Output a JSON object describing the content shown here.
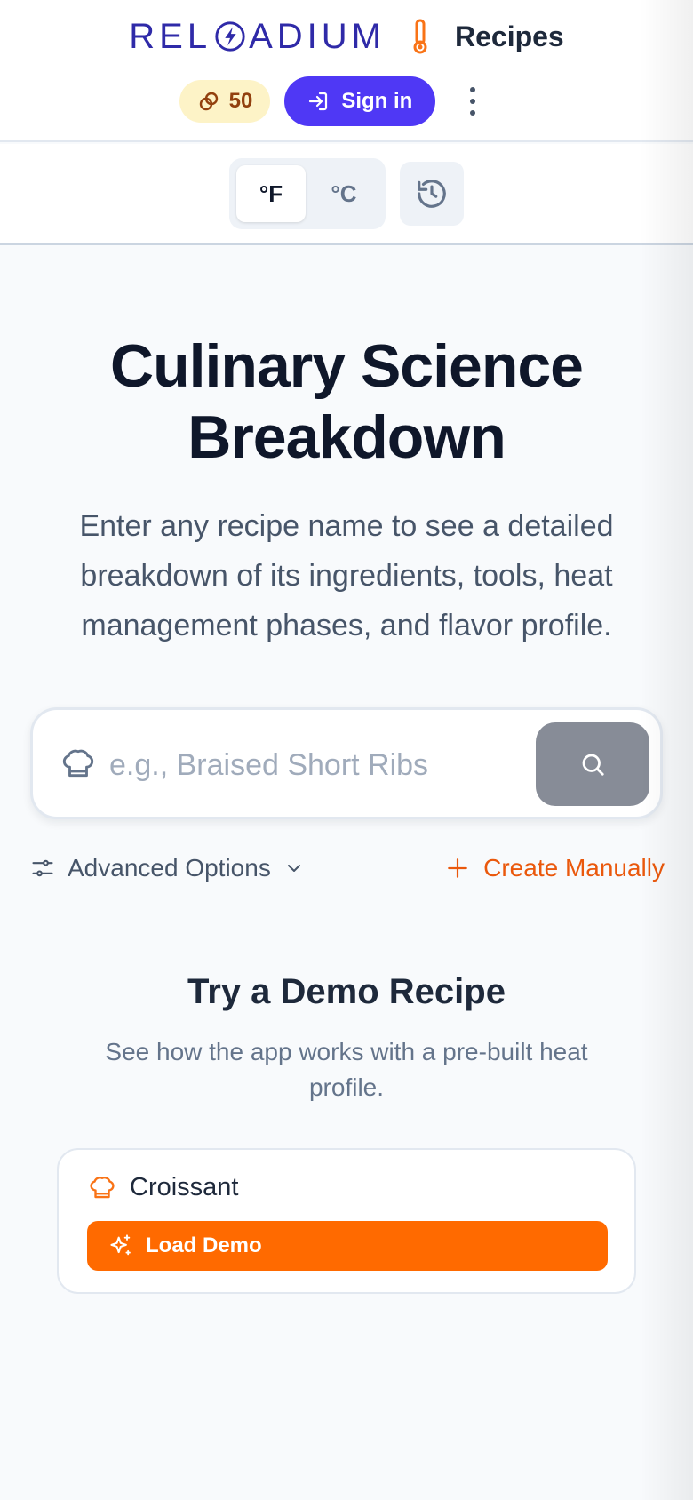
{
  "header": {
    "logo_text_left": "REL",
    "logo_text_right": "ADIUM",
    "brand_label": "Recipes",
    "credits": "50",
    "signin_label": "Sign in"
  },
  "toolbar": {
    "units": [
      "°F",
      "°C"
    ],
    "active_unit": "°F"
  },
  "hero": {
    "title_line1": "Culinary Science",
    "title_line2": "Breakdown",
    "subtitle": "Enter any recipe name to see a detailed breakdown of its ingredients, tools, heat management phases, and flavor profile."
  },
  "search": {
    "placeholder": "e.g., Braised Short Ribs",
    "value": ""
  },
  "options": {
    "advanced_label": "Advanced Options",
    "create_label": "Create Manually"
  },
  "demo": {
    "title": "Try a Demo Recipe",
    "subtitle": "See how the app works with a pre-built heat profile.",
    "recipe_name": "Croissant",
    "load_label": "Load Demo"
  },
  "colors": {
    "brand": "#2f2aa8",
    "primary": "#4f38f5",
    "accent": "#ff6a00",
    "credit_bg": "#fdf3c7"
  },
  "icons": [
    "bolt-icon",
    "thermometer-icon",
    "link-coins-icon",
    "signin-icon",
    "kebab-icon",
    "history-icon",
    "chef-hat-icon",
    "search-icon",
    "sliders-icon",
    "chevron-down-icon",
    "plus-icon",
    "sparkles-icon"
  ]
}
